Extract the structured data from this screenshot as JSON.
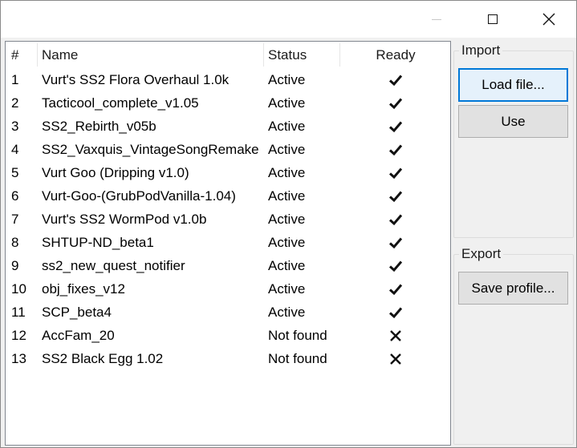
{
  "window": {
    "controls": [
      "minimize-icon",
      "maximize-icon",
      "close-icon"
    ]
  },
  "table": {
    "headers": {
      "num": "#",
      "name": "Name",
      "status": "Status",
      "ready": "Ready"
    },
    "rows": [
      {
        "num": "1",
        "name": "Vurt's SS2 Flora Overhaul 1.0k",
        "status": "Active",
        "ready": "check-icon"
      },
      {
        "num": "2",
        "name": "Tacticool_complete_v1.05",
        "status": "Active",
        "ready": "check-icon"
      },
      {
        "num": "3",
        "name": "SS2_Rebirth_v05b",
        "status": "Active",
        "ready": "check-icon"
      },
      {
        "num": "4",
        "name": "SS2_Vaxquis_VintageSongRemake",
        "status": "Active",
        "ready": "check-icon"
      },
      {
        "num": "5",
        "name": "Vurt Goo (Dripping v1.0)",
        "status": "Active",
        "ready": "check-icon"
      },
      {
        "num": "6",
        "name": "Vurt-Goo-(GrubPodVanilla-1.04)",
        "status": "Active",
        "ready": "check-icon"
      },
      {
        "num": "7",
        "name": "Vurt's SS2 WormPod v1.0b",
        "status": "Active",
        "ready": "check-icon"
      },
      {
        "num": "8",
        "name": "SHTUP-ND_beta1",
        "status": "Active",
        "ready": "check-icon"
      },
      {
        "num": "9",
        "name": "ss2_new_quest_notifier",
        "status": "Active",
        "ready": "check-icon"
      },
      {
        "num": "10",
        "name": "obj_fixes_v12",
        "status": "Active",
        "ready": "check-icon"
      },
      {
        "num": "11",
        "name": "SCP_beta4",
        "status": "Active",
        "ready": "check-icon"
      },
      {
        "num": "12",
        "name": "AccFam_20",
        "status": "Not found",
        "ready": "cross-icon"
      },
      {
        "num": "13",
        "name": "SS2 Black Egg 1.02",
        "status": "Not found",
        "ready": "cross-icon"
      }
    ]
  },
  "import_group": {
    "title": "Import",
    "load_label": "Load file...",
    "use_label": "Use"
  },
  "export_group": {
    "title": "Export",
    "save_label": "Save profile..."
  }
}
